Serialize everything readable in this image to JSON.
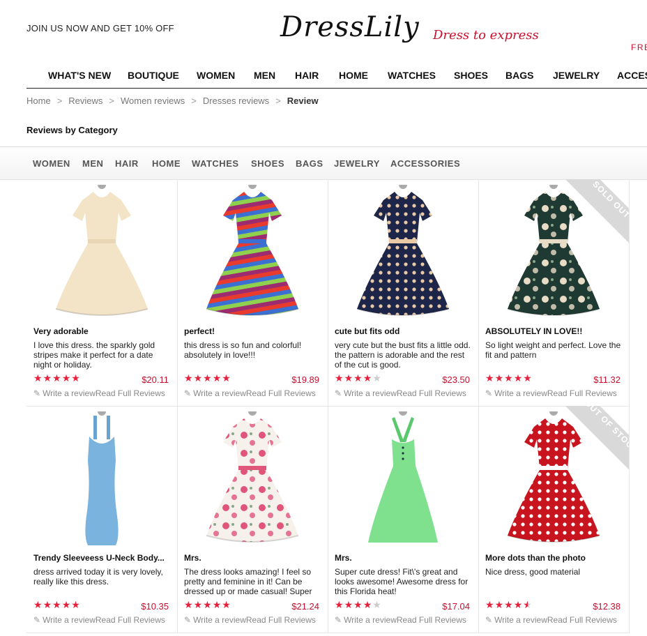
{
  "header": {
    "promo": "JOIN US NOW AND GET 10% OFF",
    "logo": "DressLily",
    "tagline": "Dress to express",
    "free_shipping": "FRE"
  },
  "main_nav": [
    "WHAT'S NEW",
    "BOUTIQUE",
    "WOMEN",
    "MEN",
    "HAIR",
    "HOME",
    "WATCHES",
    "SHOES",
    "BAGS",
    "JEWELRY",
    "ACCES"
  ],
  "breadcrumb": [
    "Home",
    "Reviews",
    "Women reviews",
    "Dresses reviews",
    "Review"
  ],
  "breadcrumb_separator": ">",
  "category_title": "Reviews by Category",
  "category_tabs": [
    "WOMEN",
    "MEN",
    "HAIR",
    "HOME",
    "WATCHES",
    "SHOES",
    "BAGS",
    "JEWELRY",
    "ACCESSORIES"
  ],
  "write_review_label": "Write a review",
  "read_full_label": "Read Full Reviews",
  "colors": {
    "accent_red": "#c8102e",
    "star_red": "#e8203b",
    "badge_gray": "#d9d9d9"
  },
  "products": [
    {
      "title": "Very adorable",
      "desc": "I love this dress. the sparkly gold stripes make it perfect for a date night or holiday.",
      "price": "$20.11",
      "rating": 5,
      "badge": "",
      "dress": {
        "color": "#f3e4c8",
        "accent": "#e8d6b4",
        "pattern": "plain",
        "shape": "aline"
      }
    },
    {
      "title": "perfect!",
      "desc": "this dress is so fun and colorful! absolutely in love!!!",
      "price": "$19.89",
      "rating": 5,
      "badge": "",
      "dress": {
        "color": "#e83b2e",
        "accent": "#3b6fd1",
        "pattern": "stripes",
        "shape": "aline"
      }
    },
    {
      "title": "cute but fits odd",
      "desc": "very cute but the bust fits a little odd. the pattern is adorable and the rest of the cut is good.",
      "price": "$23.50",
      "rating": 4,
      "badge": "",
      "dress": {
        "color": "#1d2548",
        "accent": "#e9c9a6",
        "pattern": "dots",
        "shape": "aline"
      }
    },
    {
      "title": "ABSOLUTELY IN LOVE!!",
      "desc": "So light weight and perfect. Love the fit and pattern",
      "price": "$11.32",
      "rating": 5,
      "badge": "SOLD OUT",
      "dress": {
        "color": "#1f3a32",
        "accent": "#e9dcc7",
        "pattern": "floral",
        "shape": "aline"
      }
    },
    {
      "title": "Trendy Sleeveess U-Neck Body...",
      "desc": "dress arrived today it is very lovely, really like this dress.",
      "price": "$10.35",
      "rating": 5,
      "badge": "",
      "dress": {
        "color": "#79b3de",
        "accent": "#6aa3cf",
        "pattern": "plain",
        "shape": "bodycon"
      }
    },
    {
      "title": "Mrs.",
      "desc": "The dress looks amazing! I feel so pretty and feminine in it! Can be dressed up or made casual! Super",
      "price": "$21.24",
      "rating": 5,
      "badge": "",
      "dress": {
        "color": "#f7f1ec",
        "accent": "#e0557a",
        "pattern": "floral",
        "shape": "aline"
      }
    },
    {
      "title": "Mrs.",
      "desc": "Super cute dress! Fit\\'s great and looks awesome! Awesome dress for this Florida heat!",
      "price": "$17.04",
      "rating": 4,
      "badge": "",
      "dress": {
        "color": "#7fe08e",
        "accent": "#5cc86d",
        "pattern": "plain",
        "shape": "halter"
      }
    },
    {
      "title": "More dots than the photo",
      "desc": "Nice dress, good material",
      "price": "$12.38",
      "rating": 4.5,
      "badge": "OUT OF STOCK",
      "dress": {
        "color": "#c8141f",
        "accent": "#ffffff",
        "pattern": "dots",
        "shape": "aline"
      }
    }
  ]
}
